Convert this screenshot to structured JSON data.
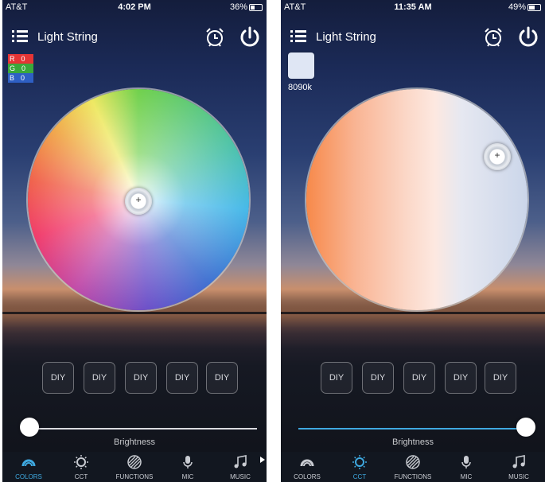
{
  "left": {
    "status": {
      "carrier": "AT&T",
      "time": "4:02 PM",
      "battery": "36%"
    },
    "header": {
      "title": "Light String"
    },
    "rgb": {
      "r_label": "R",
      "r_value": "0",
      "g_label": "G",
      "g_value": "0",
      "b_label": "B",
      "b_value": "0"
    },
    "diy_buttons": [
      "DIY",
      "DIY",
      "DIY",
      "DIY",
      "DIY"
    ],
    "brightness": {
      "label": "Brightness",
      "level": 0.0
    },
    "tabs": [
      "COLORS",
      "CCT",
      "FUNCTIONS",
      "MIC",
      "MUSIC"
    ],
    "active_tab": "COLORS"
  },
  "right": {
    "status": {
      "carrier": "AT&T",
      "time": "11:35 AM",
      "battery": "49%"
    },
    "header": {
      "title": "Light String"
    },
    "cct": {
      "value": "8090k",
      "swatch_color": "#dfe6f4"
    },
    "diy_buttons": [
      "DIY",
      "DIY",
      "DIY",
      "DIY",
      "DIY"
    ],
    "brightness": {
      "label": "Brightness",
      "level": 1.0
    },
    "tabs": [
      "COLORS",
      "CCT",
      "FUNCTIONS",
      "MIC",
      "MUSIC"
    ],
    "active_tab": "CCT"
  },
  "colors": {
    "accent": "#3fa9e0",
    "tabbar_bg": "#121720"
  }
}
